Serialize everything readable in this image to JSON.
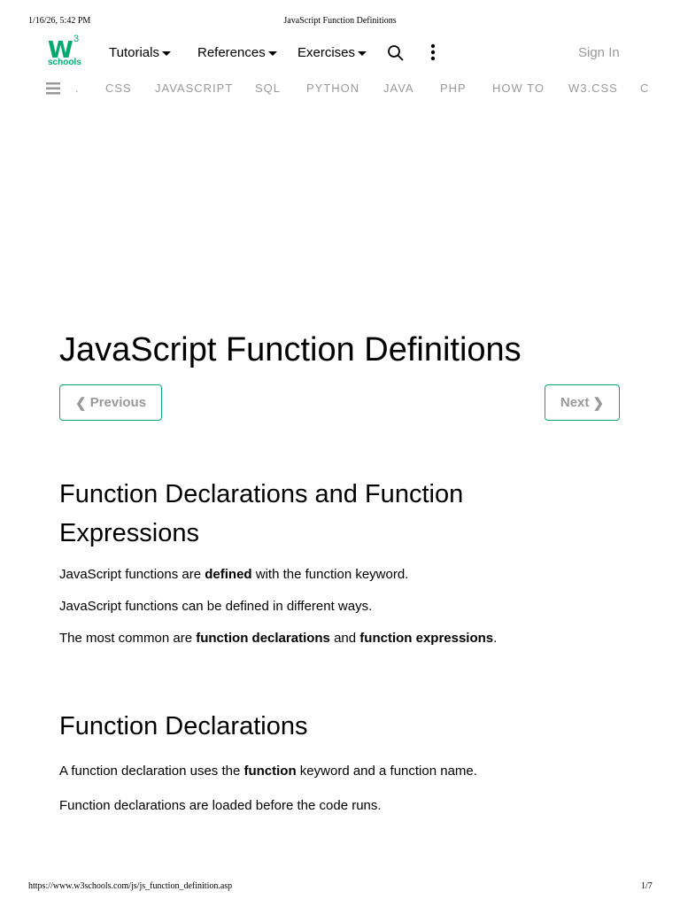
{
  "print_header": {
    "datetime": "1/16/26, 5:42 PM",
    "title": "JavaScript Function Definitions"
  },
  "print_footer": {
    "url": "https://www.w3schools.com/js/js_function_definition.asp",
    "page": "1/7"
  },
  "logo": {
    "text": "schools",
    "sup": "3",
    "w": "W"
  },
  "nav": {
    "tutorials": "Tutorials",
    "references": "References",
    "exercises": "Exercises",
    "sign_in": "Sign In"
  },
  "topics": [
    ".",
    "CSS",
    "JAVASCRIPT",
    "SQL",
    "PYTHON",
    "JAVA",
    "PHP",
    "HOW TO",
    "W3.CSS",
    "C"
  ],
  "page": {
    "title": "JavaScript Function Definitions",
    "previous": "Previous",
    "next": "Next",
    "h2a": "Function Declarations and Function Expressions",
    "p1": [
      "JavaScript functions are ",
      "defined",
      " with the function keyword."
    ],
    "p2": "JavaScript functions can be defined in different ways.",
    "p3": [
      "The most common are ",
      "function declarations",
      " and ",
      "function expressions",
      "."
    ],
    "h2b": "Function Declarations",
    "p4": [
      "A function declaration uses the ",
      "function",
      " keyword and a function name."
    ],
    "p5": "Function declarations are loaded before the code runs."
  },
  "colors": {
    "accent": "#04AA6D"
  }
}
